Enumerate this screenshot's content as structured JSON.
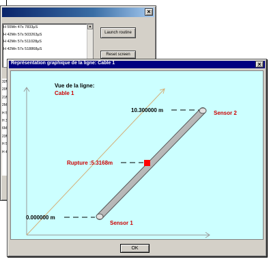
{
  "background_window": {
    "close_glyph": "×",
    "log_lines": [
      "H 55Mn 47s 7833µS",
      "H 42Mn 57s 503263µS",
      "H 42Mn 57s 511028µS",
      "H 42Mn 57s 518868µS"
    ],
    "side_lines": [
      "32M",
      "20M",
      "21M",
      "2M",
      "H 53",
      "H 37",
      "6M",
      "23M",
      "H 55",
      "H 42"
    ],
    "buttons": {
      "launch": "Launch routine",
      "reset": "Reset screen"
    },
    "scroll_up_glyph": "▲"
  },
  "graph_window": {
    "title": "Représentation graphique de la ligne: Cable 1",
    "close_glyph": "×",
    "view_heading": "Vue de la ligne:",
    "cable_name": "Cable 1",
    "end_distance": "10.300000 m",
    "start_distance": "0.000000 m",
    "rupture_label": "Rupture :5.3168m",
    "sensor1": "Sensor 1",
    "sensor2": "Sensor 2",
    "ok_label": "OK",
    "colors": {
      "label_red": "#cc0000",
      "canvas_bg": "#ccffff",
      "rupture_marker": "#ff0000",
      "axis": "#999999",
      "diagonal": "#d4b07a"
    }
  }
}
